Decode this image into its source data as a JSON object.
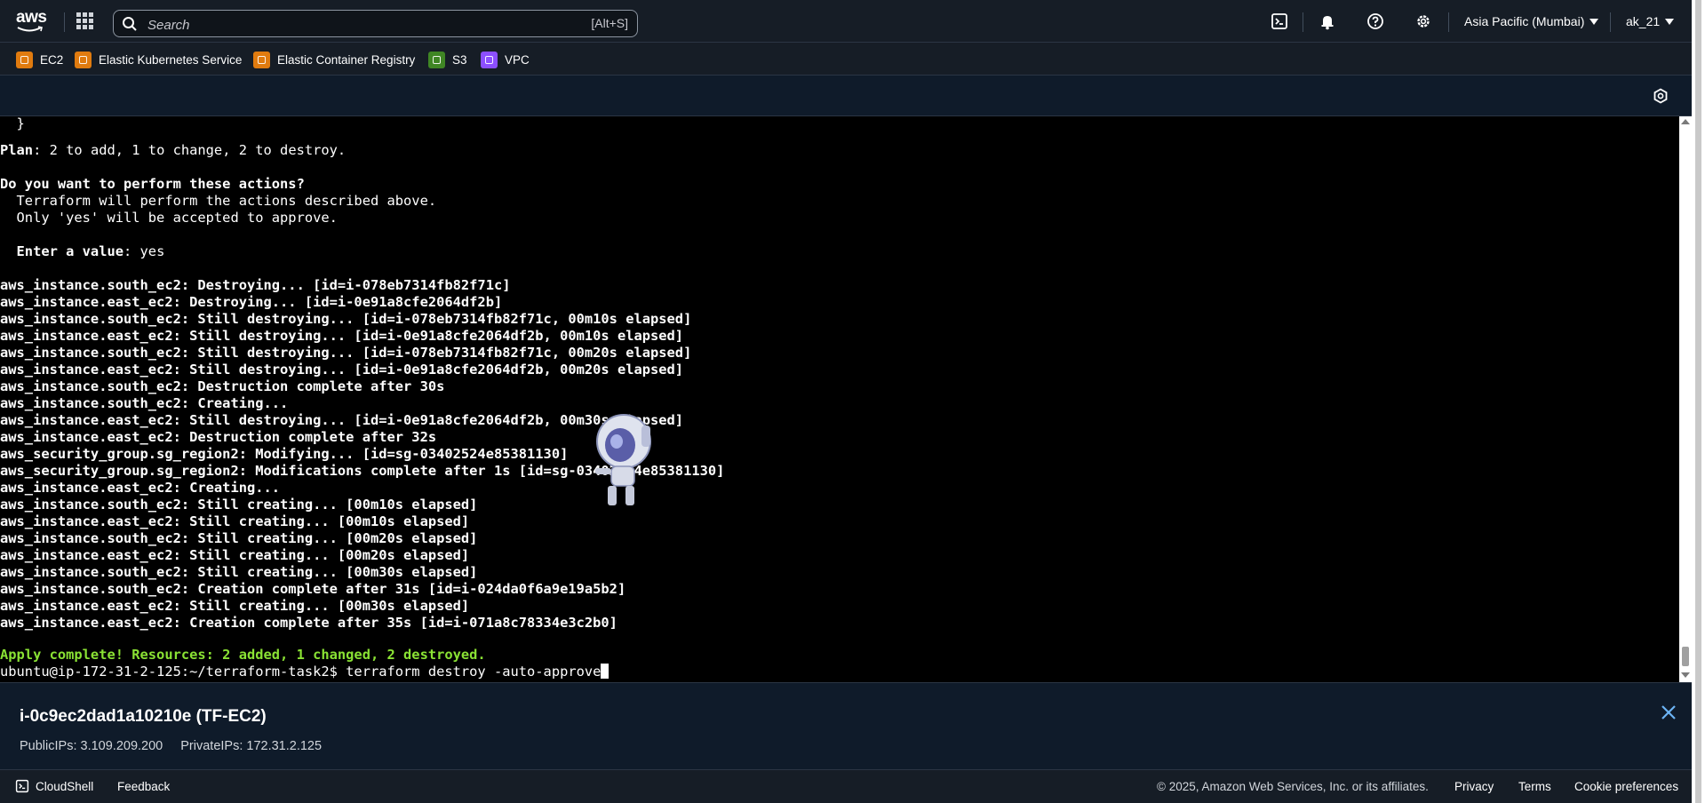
{
  "nav": {
    "logo": "aws",
    "search_placeholder": "Search",
    "search_shortcut": "[Alt+S]",
    "region": "Asia Pacific (Mumbai)",
    "user": "ak_21",
    "icons": [
      "cloudshell-icon",
      "bell-icon",
      "help-icon",
      "gear-icon"
    ]
  },
  "favorites": [
    {
      "label": "EC2",
      "color": "#e07b0f"
    },
    {
      "label": "Elastic Kubernetes Service",
      "color": "#e07b0f"
    },
    {
      "label": "Elastic Container Registry",
      "color": "#e07b0f"
    },
    {
      "label": "S3",
      "color": "#3f8624"
    },
    {
      "label": "VPC",
      "color": "#8c4fff"
    }
  ],
  "terminal": {
    "lines": [
      {
        "bold": "",
        "text": "  }"
      },
      {
        "bold": "",
        "text": ""
      },
      {
        "bold": "Plan",
        "text": ": 2 to add, 1 to change, 2 to destroy."
      },
      {
        "bold": "",
        "text": ""
      },
      {
        "bold": "Do you want to perform these actions?",
        "text": ""
      },
      {
        "bold": "",
        "text": "  Terraform will perform the actions described above."
      },
      {
        "bold": "",
        "text": "  Only 'yes' will be accepted to approve."
      },
      {
        "bold": "",
        "text": ""
      },
      {
        "bold": "  Enter a value",
        "text": ": yes"
      },
      {
        "bold": "",
        "text": ""
      },
      {
        "bold": "aws_instance.south_ec2: Destroying... [id=i-078eb7314fb82f71c]",
        "text": ""
      },
      {
        "bold": "aws_instance.east_ec2: Destroying... [id=i-0e91a8cfe2064df2b]",
        "text": ""
      },
      {
        "bold": "aws_instance.south_ec2: Still destroying... [id=i-078eb7314fb82f71c, 00m10s elapsed]",
        "text": ""
      },
      {
        "bold": "aws_instance.east_ec2: Still destroying... [id=i-0e91a8cfe2064df2b, 00m10s elapsed]",
        "text": ""
      },
      {
        "bold": "aws_instance.south_ec2: Still destroying... [id=i-078eb7314fb82f71c, 00m20s elapsed]",
        "text": ""
      },
      {
        "bold": "aws_instance.east_ec2: Still destroying... [id=i-0e91a8cfe2064df2b, 00m20s elapsed]",
        "text": ""
      },
      {
        "bold": "aws_instance.south_ec2: Destruction complete after 30s",
        "text": ""
      },
      {
        "bold": "aws_instance.south_ec2: Creating...",
        "text": ""
      },
      {
        "bold": "aws_instance.east_ec2: Still destroying... [id=i-0e91a8cfe2064df2b, 00m30s elapsed]",
        "text": ""
      },
      {
        "bold": "aws_instance.east_ec2: Destruction complete after 32s",
        "text": ""
      },
      {
        "bold": "aws_security_group.sg_region2: Modifying... [id=sg-03402524e85381130]",
        "text": ""
      },
      {
        "bold": "aws_security_group.sg_region2: Modifications complete after 1s [id=sg-03402524e85381130]",
        "text": ""
      },
      {
        "bold": "aws_instance.east_ec2: Creating...",
        "text": ""
      },
      {
        "bold": "aws_instance.south_ec2: Still creating... [00m10s elapsed]",
        "text": ""
      },
      {
        "bold": "aws_instance.east_ec2: Still creating... [00m10s elapsed]",
        "text": ""
      },
      {
        "bold": "aws_instance.south_ec2: Still creating... [00m20s elapsed]",
        "text": ""
      },
      {
        "bold": "aws_instance.east_ec2: Still creating... [00m20s elapsed]",
        "text": ""
      },
      {
        "bold": "aws_instance.south_ec2: Still creating... [00m30s elapsed]",
        "text": ""
      },
      {
        "bold": "aws_instance.south_ec2: Creation complete after 31s [id=i-024da0f6a9e19a5b2]",
        "text": ""
      },
      {
        "bold": "aws_instance.east_ec2: Still creating... [00m30s elapsed]",
        "text": ""
      },
      {
        "bold": "aws_instance.east_ec2: Creation complete after 35s [id=i-071a8c78334e3c2b0]",
        "text": ""
      },
      {
        "bold": "",
        "text": ""
      }
    ],
    "apply_message": "Apply complete! Resources: 2 added, 1 changed, 2 destroyed.",
    "prompt": "ubuntu@ip-172-31-2-125:~/terraform-task2$ terraform destroy -auto-approve"
  },
  "instance": {
    "title": "i-0c9ec2dad1a10210e (TF-EC2)",
    "public_ips": "PublicIPs: 3.109.209.200",
    "private_ips": "PrivateIPs: 172.31.2.125"
  },
  "footer": {
    "cloudshell": "CloudShell",
    "feedback": "Feedback",
    "copyright": "© 2025, Amazon Web Services, Inc. or its affiliates.",
    "privacy": "Privacy",
    "terms": "Terms",
    "cookie": "Cookie preferences"
  }
}
